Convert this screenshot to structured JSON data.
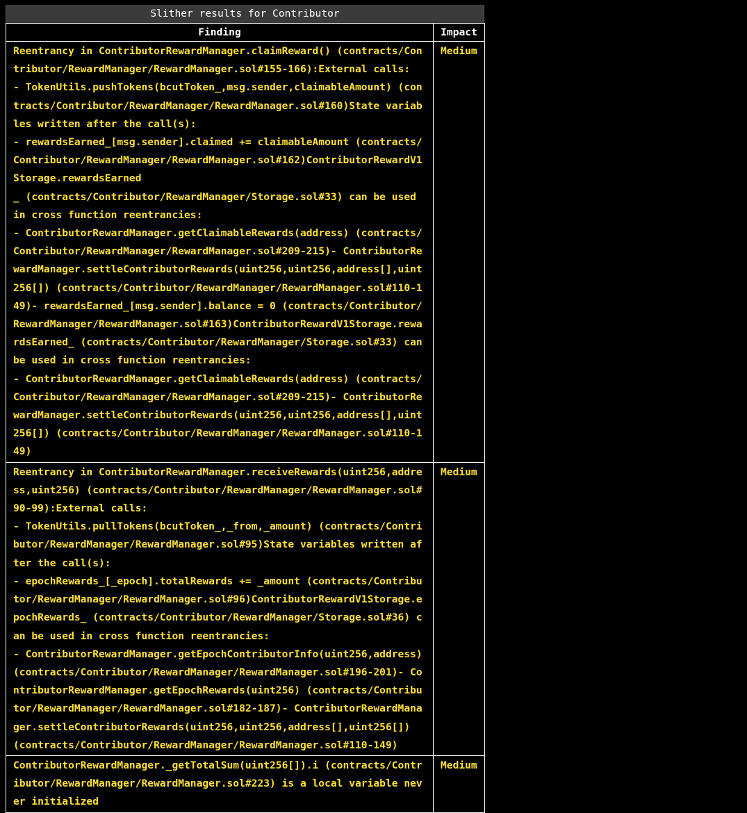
{
  "report": {
    "title": "Slither results for Contributor",
    "headers": {
      "finding": "Finding",
      "impact": "Impact"
    },
    "rows": [
      {
        "finding": "Reentrancy in ContributorRewardManager.claimReward() (contracts/Contributor/RewardManager/RewardManager.sol#155-166):External calls:\n- TokenUtils.pushTokens(bcutToken_,msg.sender,claimableAmount) (contracts/Contributor/RewardManager/RewardManager.sol#160)State variables written after the call(s):\n- rewardsEarned_[msg.sender].claimed += claimableAmount (contracts/Contributor/RewardManager/RewardManager.sol#162)ContributorRewardV1Storage.rewardsEarned\n_ (contracts/Contributor/RewardManager/Storage.sol#33) can be used in cross function reentrancies:\n- ContributorRewardManager.getClaimableRewards(address) (contracts/Contributor/RewardManager/RewardManager.sol#209-215)- ContributorRewardManager.settleContributorRewards(uint256,uint256,address[],uint256[]) (contracts/Contributor/RewardManager/RewardManager.sol#110-149)- rewardsEarned_[msg.sender].balance = 0 (contracts/Contributor/RewardManager/RewardManager.sol#163)ContributorRewardV1Storage.rewardsEarned_ (contracts/Contributor/RewardManager/Storage.sol#33) can be used in cross function reentrancies:\n- ContributorRewardManager.getClaimableRewards(address) (contracts/Contributor/RewardManager/RewardManager.sol#209-215)- ContributorRewardManager.settleContributorRewards(uint256,uint256,address[],uint256[]) (contracts/Contributor/RewardManager/RewardManager.sol#110-149)",
        "impact": "Medium"
      },
      {
        "finding": "Reentrancy in ContributorRewardManager.receiveRewards(uint256,address,uint256) (contracts/Contributor/RewardManager/RewardManager.sol#90-99):External calls:\n- TokenUtils.pullTokens(bcutToken_,_from,_amount) (contracts/Contributor/RewardManager/RewardManager.sol#95)State variables written after the call(s):\n- epochRewards_[_epoch].totalRewards += _amount (contracts/Contributor/RewardManager/RewardManager.sol#96)ContributorRewardV1Storage.epochRewards_ (contracts/Contributor/RewardManager/Storage.sol#36) can be used in cross function reentrancies:\n- ContributorRewardManager.getEpochContributorInfo(uint256,address) (contracts/Contributor/RewardManager/RewardManager.sol#196-201)- ContributorRewardManager.getEpochRewards(uint256) (contracts/Contributor/RewardManager/RewardManager.sol#182-187)- ContributorRewardManager.settleContributorRewards(uint256,uint256,address[],uint256[]) (contracts/Contributor/RewardManager/RewardManager.sol#110-149)",
        "impact": "Medium"
      },
      {
        "finding": "ContributorRewardManager._getTotalSum(uint256[]).i (contracts/Contributor/RewardManager/RewardManager.sol#223) is a local variable never initialized",
        "impact": "Medium"
      }
    ]
  },
  "colors": {
    "background": "#000000",
    "title_bar": "#3a3a3a",
    "header_text": "#ffffff",
    "finding_text": "#ffe135",
    "border": "#ffffff"
  }
}
